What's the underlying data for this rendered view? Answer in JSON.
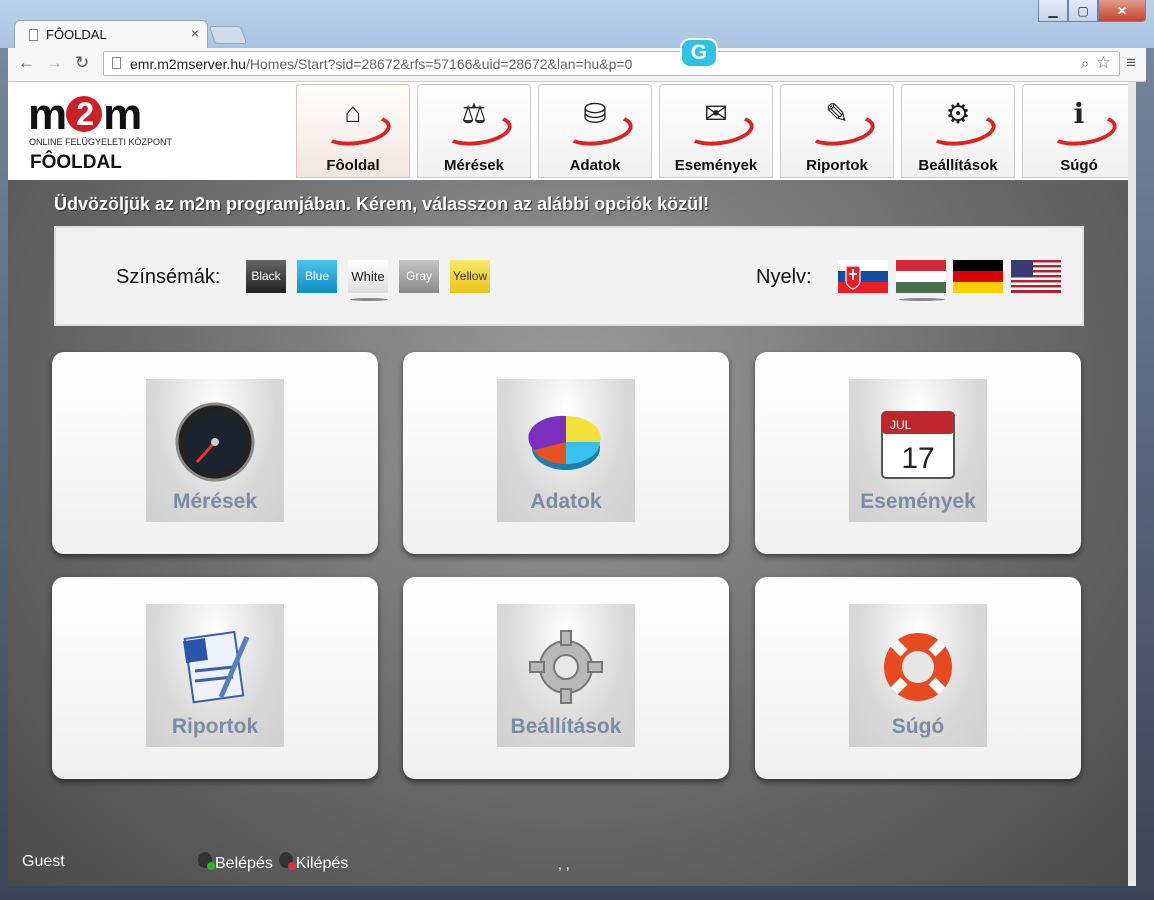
{
  "browser": {
    "tab_title": "FÔOLDAL",
    "tab_close": "×",
    "url_host": "emr.m2mserver.hu",
    "url_path": "/Homes/Start?sid=28672&rfs=57166&uid=28672&lan=hu&p=0",
    "back": "←",
    "forward": "→",
    "reload": "↻",
    "zoom_icon": "⌕",
    "star_icon": "☆",
    "menu_icon": "≡",
    "extension_letter": "G"
  },
  "header": {
    "logo_m1": "m",
    "logo_2": "2",
    "logo_m2": "m",
    "logo_subtitle": "ONLINE FELÜGYELETI KÖZPONT",
    "page_name": "FÔOLDAL"
  },
  "nav": [
    {
      "label": "Fôoldal",
      "icon": "⌂",
      "active": true
    },
    {
      "label": "Mérések",
      "icon": "⚖"
    },
    {
      "label": "Adatok",
      "icon": "⛁"
    },
    {
      "label": "Események",
      "icon": "✉"
    },
    {
      "label": "Riportok",
      "icon": "✎"
    },
    {
      "label": "Beállítások",
      "icon": "⚙"
    },
    {
      "label": "Súgó",
      "icon": "ℹ"
    }
  ],
  "welcome": "Üdvözöljük az m2m programjában. Kérem, válasszon az alábbi opciók közül!",
  "settings": {
    "scheme_label": "Színsémák:",
    "schemes": [
      {
        "label": "Black",
        "color": "#444444"
      },
      {
        "label": "Blue",
        "color": "#1fa2d8"
      },
      {
        "label": "White",
        "color": "#f4f4f4"
      },
      {
        "label": "Gray",
        "color": "#9a9a9a"
      },
      {
        "label": "Yellow",
        "color": "#f2d427"
      }
    ],
    "language_label": "Nyelv:",
    "languages": [
      "Slovak",
      "Hungarian",
      "German",
      "English (US)"
    ]
  },
  "cards": [
    {
      "label": "Mérések",
      "icon": "gauge-icon",
      "glyph": "◉"
    },
    {
      "label": "Adatok",
      "icon": "pie-chart-icon",
      "glyph": "◕"
    },
    {
      "label": "Események",
      "icon": "calendar-icon",
      "glyph": "17",
      "glyph_top": "JUL"
    },
    {
      "label": "Riportok",
      "icon": "document-icon",
      "glyph": "✍"
    },
    {
      "label": "Beállítások",
      "icon": "gear-icon",
      "glyph": "⚙"
    },
    {
      "label": "Súgó",
      "icon": "lifebuoy-icon",
      "glyph": "◎"
    }
  ],
  "footer": {
    "user": "Guest",
    "login": "Belépés",
    "logout": "Kilépés",
    "dots": ", ,"
  }
}
